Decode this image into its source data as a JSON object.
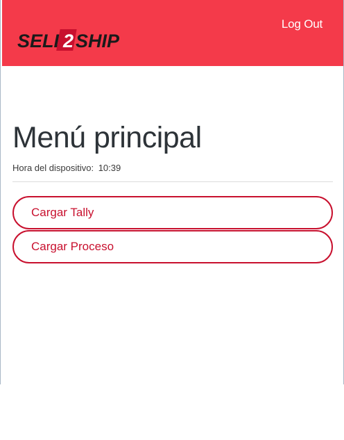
{
  "header": {
    "logo_text": "SELL2SHIP",
    "logout_label": "Log Out"
  },
  "main": {
    "title": "Menú principal",
    "device_time_label": "Hora del dispositivo:",
    "device_time_value": "10:39",
    "buttons": [
      {
        "label": "Cargar Tally"
      },
      {
        "label": "Cargar Proceso"
      }
    ]
  },
  "colors": {
    "header_bg": "#f43a4a",
    "accent": "#c8102e",
    "logo_dark": "#1a1a1a",
    "logo_red": "#c8102e"
  }
}
